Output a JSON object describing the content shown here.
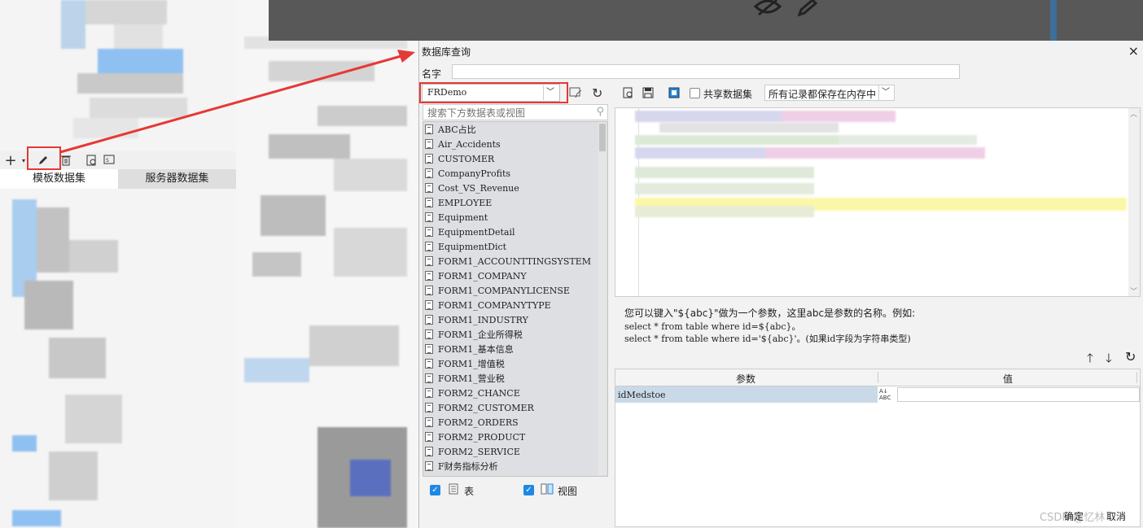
{
  "left_panel": {
    "tabs": [
      {
        "label": "模板数据集"
      },
      {
        "label": "服务器数据集"
      }
    ],
    "toolbar": {
      "icons": [
        "plus-icon",
        "edit-icon",
        "delete-icon",
        "preview-icon",
        "sql-icon"
      ]
    }
  },
  "dialog": {
    "title": "数据库查询",
    "close_label": "×",
    "name_label": "名字",
    "name_value": "",
    "datasource": {
      "selected": "FRDemo"
    },
    "search": {
      "placeholder": "搜索下方数据表或视图"
    },
    "tables": [
      "ABC占比",
      "Air_Accidents",
      "CUSTOMER",
      "CompanyProfits",
      "Cost_VS_Revenue",
      "EMPLOYEE",
      "Equipment",
      "EquipmentDetail",
      "EquipmentDict",
      "FORM1_ACCOUNTTINGSYSTEM",
      "FORM1_COMPANY",
      "FORM1_COMPANYLICENSE",
      "FORM1_COMPANYTYPE",
      "FORM1_INDUSTRY",
      "FORM1_企业所得税",
      "FORM1_基本信息",
      "FORM1_增值税",
      "FORM1_营业税",
      "FORM2_CHANCE",
      "FORM2_CUSTOMER",
      "FORM2_ORDERS",
      "FORM2_PRODUCT",
      "FORM2_SERVICE",
      "F财务指标分析"
    ],
    "filters": {
      "table_label": "表",
      "view_label": "视图"
    },
    "toolbar": {
      "shared_label": "共享数据集",
      "cache_option": "所有记录都保存在内存中"
    },
    "hint": {
      "line1": "您可以键入\"${abc}\"做为一个参数，这里abc是参数的名称。例如:",
      "line2": "select * from table where id=${abc}。",
      "line3": "select * from table where id='${abc}'。(如果id字段为字符串类型)"
    },
    "params": {
      "col_param": "参数",
      "col_value": "值",
      "rows": [
        {
          "name": "idMedstoe",
          "value": ""
        }
      ]
    },
    "footer": {
      "ok_label": "确定",
      "cancel_label": "取消",
      "watermark": "CSDN @忆林"
    }
  },
  "colors": {
    "highlight": "#e53935",
    "check": "#1e88e5",
    "selected_row": "#c9d9e8"
  }
}
